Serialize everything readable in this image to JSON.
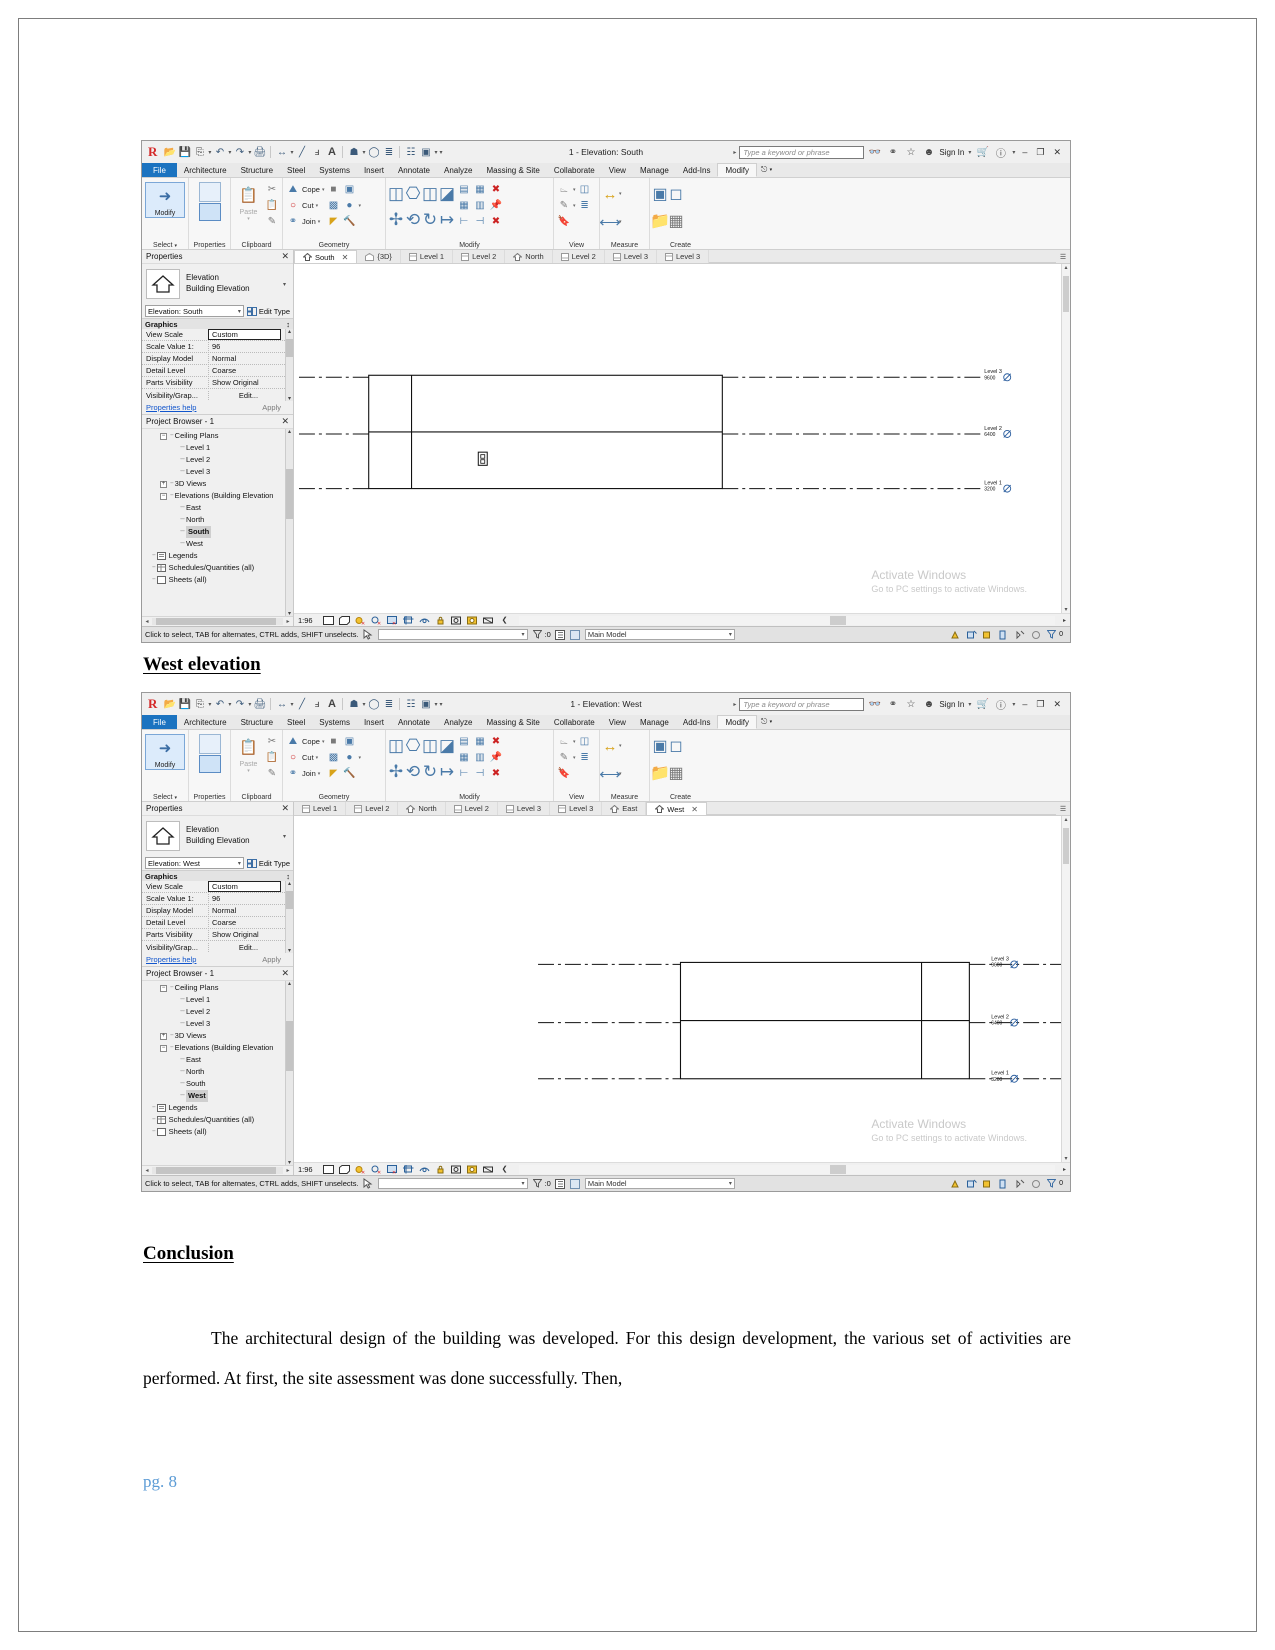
{
  "document": {
    "heading_west": "West elevation",
    "heading_conclusion": "Conclusion",
    "paragraph_line1": "The architectural design of the building was developed. For this design development, the",
    "paragraph_line2": "various set of activities are performed. At first, the site assessment was done successfully. Then,",
    "page_number": "pg. 8"
  },
  "windows": [
    {
      "id": "south",
      "title": "1 - Elevation: South",
      "quick_access": {
        "logo": "revit-logo",
        "tools": [
          "open-icon",
          "save-icon",
          "save-as-icon",
          "undo-icon",
          "redo-icon",
          "print-icon",
          "measure-icon",
          "aligned-dimension-icon",
          "tag-icon",
          "text-icon",
          "default-3d-view-icon",
          "section-icon",
          "thin-lines-icon",
          "close-hidden-windows-icon",
          "switch-windows-icon",
          "customize-qat-icon"
        ]
      },
      "search": {
        "placeholder": "Type a keyword or phrase",
        "value": ""
      },
      "account": {
        "search_icon": "binoculars-icon",
        "community_icon": "community-icon",
        "favorites_icon": "star-icon",
        "user_icon": "person-icon",
        "sign_in": "Sign In",
        "caret": "▾",
        "cart_icon": "cart-icon",
        "help_icon": "help-icon"
      },
      "window_buttons": {
        "minimize": "–",
        "restore": "❐",
        "close": "✕"
      },
      "ribbon_tabs": [
        {
          "label": "File",
          "kind": "file"
        },
        {
          "label": "Architecture",
          "kind": "normal"
        },
        {
          "label": "Structure",
          "kind": "normal"
        },
        {
          "label": "Steel",
          "kind": "normal"
        },
        {
          "label": "Systems",
          "kind": "normal"
        },
        {
          "label": "Insert",
          "kind": "normal"
        },
        {
          "label": "Annotate",
          "kind": "normal"
        },
        {
          "label": "Analyze",
          "kind": "normal"
        },
        {
          "label": "Massing & Site",
          "kind": "normal"
        },
        {
          "label": "Collaborate",
          "kind": "normal"
        },
        {
          "label": "View",
          "kind": "normal"
        },
        {
          "label": "Manage",
          "kind": "normal"
        },
        {
          "label": "Add-Ins",
          "kind": "normal"
        },
        {
          "label": "Modify",
          "kind": "active"
        }
      ],
      "ribbon_panels": [
        {
          "label": "Select",
          "big": "Modify"
        },
        {
          "label": "Properties"
        },
        {
          "label": "Clipboard",
          "items": [
            "Paste"
          ]
        },
        {
          "label": "Geometry",
          "items": [
            "Cope",
            "Cut",
            "Join"
          ]
        },
        {
          "label": "Modify"
        },
        {
          "label": "View"
        },
        {
          "label": "Measure"
        },
        {
          "label": "Create"
        }
      ],
      "properties": {
        "panel_title": "Properties",
        "close": "✕",
        "family": "Elevation",
        "type": "Building Elevation",
        "type_selector": "Elevation: South",
        "edit_type": "Edit Type",
        "group_title": "Graphics",
        "group_badge": "↕",
        "rows": [
          {
            "key": "View Scale",
            "value": "Custom",
            "boxed": true
          },
          {
            "key": "Scale Value    1:",
            "value": "96",
            "boxed": false
          },
          {
            "key": "Display Model",
            "value": "Normal",
            "boxed": false
          },
          {
            "key": "Detail Level",
            "value": "Coarse",
            "boxed": false
          },
          {
            "key": "Parts Visibility",
            "value": "Show Original",
            "boxed": false
          },
          {
            "key": "Visibility/Grap...",
            "value": "Edit...",
            "boxed": false
          }
        ],
        "help_link": "Properties help",
        "apply": "Apply"
      },
      "project_browser": {
        "title": "Project Browser - 1",
        "close": "✕",
        "nodes": [
          {
            "label": "Ceiling Plans",
            "level": 1,
            "toggle": "-"
          },
          {
            "label": "Level 1",
            "level": 2,
            "toggle": ""
          },
          {
            "label": "Level 2",
            "level": 2,
            "toggle": ""
          },
          {
            "label": "Level 3",
            "level": 2,
            "toggle": ""
          },
          {
            "label": "3D Views",
            "level": 1,
            "toggle": "+"
          },
          {
            "label": "Elevations (Building Elevation",
            "level": 1,
            "toggle": "-"
          },
          {
            "label": "East",
            "level": 2,
            "toggle": ""
          },
          {
            "label": "North",
            "level": 2,
            "toggle": ""
          },
          {
            "label": "South",
            "level": 2,
            "toggle": "",
            "selected": true
          },
          {
            "label": "West",
            "level": 2,
            "toggle": ""
          },
          {
            "label": "Legends",
            "level": 1,
            "toggle": "",
            "icon": "legend-icon"
          },
          {
            "label": "Schedules/Quantities (all)",
            "level": 1,
            "toggle": "",
            "icon": "schedule-icon"
          },
          {
            "label": "Sheets (all)",
            "level": 1,
            "toggle": "",
            "icon": "sheet-icon"
          }
        ]
      },
      "view_tabs": [
        {
          "label": "South",
          "icon": "elevation-icon",
          "active": true,
          "closable": true
        },
        {
          "label": "{3D}",
          "icon": "3d-icon",
          "active": false
        },
        {
          "label": "Level 1",
          "icon": "plan-icon",
          "active": false
        },
        {
          "label": "Level 2",
          "icon": "plan-icon",
          "active": false
        },
        {
          "label": "North",
          "icon": "elevation-icon",
          "active": false
        },
        {
          "label": "Level 2",
          "icon": "ceiling-icon",
          "active": false
        },
        {
          "label": "Level 3",
          "icon": "ceiling-icon",
          "active": false
        },
        {
          "label": "Level 3",
          "icon": "plan-icon",
          "active": false
        }
      ],
      "canvas": {
        "levels": [
          {
            "name": "Level 3",
            "elev": "9600"
          },
          {
            "name": "Level 2",
            "elev": "6400"
          },
          {
            "name": "Level 1",
            "elev": "3200"
          }
        ],
        "watermark_line1": "Activate Windows",
        "watermark_line2": "Go to PC settings to activate Windows."
      },
      "view_control_bar": {
        "scale": "1:96",
        "icons": [
          "detail-level-icon",
          "visual-style-icon",
          "sun-path-icon",
          "shadows-icon",
          "rendering-dialog-icon",
          "crop-view-icon",
          "show-crop-region-icon",
          "lock-3d-view-icon",
          "temporary-hide-isolate-icon",
          "reveal-hidden-elements-icon",
          "analytical-model-icon",
          "constraints-icon"
        ]
      },
      "status_bar": {
        "message": "Click to select, TAB for alternates, CTRL adds, SHIFT unselects.",
        "press_drag_icon": "press-and-drag-icon",
        "filter_value": "",
        "selection_count": ":0",
        "model_selector": "Main Model",
        "right_icons": [
          "worksets-icon",
          "design-options-icon",
          "exclude-options-icon",
          "active-workset-icon",
          "editable-only-icon",
          "select-link-icon",
          "filter-icon"
        ],
        "filter_count": "0"
      }
    },
    {
      "id": "west",
      "title": "1 - Elevation: West",
      "search": {
        "placeholder": "Type a keyword or phrase",
        "value": ""
      },
      "account": {
        "sign_in": "Sign In"
      },
      "properties": {
        "panel_title": "Properties",
        "family": "Elevation",
        "type": "Building Elevation",
        "type_selector": "Elevation: West",
        "edit_type": "Edit Type",
        "group_title": "Graphics",
        "rows": [
          {
            "key": "View Scale",
            "value": "Custom",
            "boxed": true
          },
          {
            "key": "Scale Value    1:",
            "value": "96",
            "boxed": false
          },
          {
            "key": "Display Model",
            "value": "Normal",
            "boxed": false
          },
          {
            "key": "Detail Level",
            "value": "Coarse",
            "boxed": false
          },
          {
            "key": "Parts Visibility",
            "value": "Show Original",
            "boxed": false
          },
          {
            "key": "Visibility/Grap...",
            "value": "Edit...",
            "boxed": false
          }
        ],
        "help_link": "Properties help",
        "apply": "Apply"
      },
      "project_browser": {
        "title": "Project Browser - 1",
        "nodes": [
          {
            "label": "Ceiling Plans",
            "level": 1,
            "toggle": "-"
          },
          {
            "label": "Level 1",
            "level": 2,
            "toggle": ""
          },
          {
            "label": "Level 2",
            "level": 2,
            "toggle": ""
          },
          {
            "label": "Level 3",
            "level": 2,
            "toggle": ""
          },
          {
            "label": "3D Views",
            "level": 1,
            "toggle": "+"
          },
          {
            "label": "Elevations (Building Elevation",
            "level": 1,
            "toggle": "-"
          },
          {
            "label": "East",
            "level": 2,
            "toggle": ""
          },
          {
            "label": "North",
            "level": 2,
            "toggle": ""
          },
          {
            "label": "South",
            "level": 2,
            "toggle": ""
          },
          {
            "label": "West",
            "level": 2,
            "toggle": "",
            "selected": true
          },
          {
            "label": "Legends",
            "level": 1,
            "toggle": "",
            "icon": "legend-icon"
          },
          {
            "label": "Schedules/Quantities (all)",
            "level": 1,
            "toggle": "",
            "icon": "schedule-icon"
          },
          {
            "label": "Sheets (all)",
            "level": 1,
            "toggle": "",
            "icon": "sheet-icon"
          }
        ]
      },
      "view_tabs": [
        {
          "label": "Level 1",
          "icon": "plan-icon",
          "active": false
        },
        {
          "label": "Level 2",
          "icon": "plan-icon",
          "active": false
        },
        {
          "label": "North",
          "icon": "elevation-icon",
          "active": false
        },
        {
          "label": "Level 2",
          "icon": "ceiling-icon",
          "active": false
        },
        {
          "label": "Level 3",
          "icon": "ceiling-icon",
          "active": false
        },
        {
          "label": "Level 3",
          "icon": "plan-icon",
          "active": false
        },
        {
          "label": "East",
          "icon": "elevation-icon",
          "active": false
        },
        {
          "label": "West",
          "icon": "elevation-icon",
          "active": true,
          "closable": true
        }
      ],
      "canvas": {
        "levels": [
          {
            "name": "Level 3",
            "elev": "9600"
          },
          {
            "name": "Level 2",
            "elev": "6400"
          },
          {
            "name": "Level 1",
            "elev": "3200"
          }
        ],
        "watermark_line1": "Activate Windows",
        "watermark_line2": "Go to PC settings to activate Windows."
      },
      "view_control_bar": {
        "scale": "1:96"
      },
      "status_bar": {
        "message": "Click to select, TAB for alternates, CTRL adds, SHIFT unselects.",
        "selection_count": ":0",
        "model_selector": "Main Model",
        "filter_count": "0"
      }
    }
  ]
}
